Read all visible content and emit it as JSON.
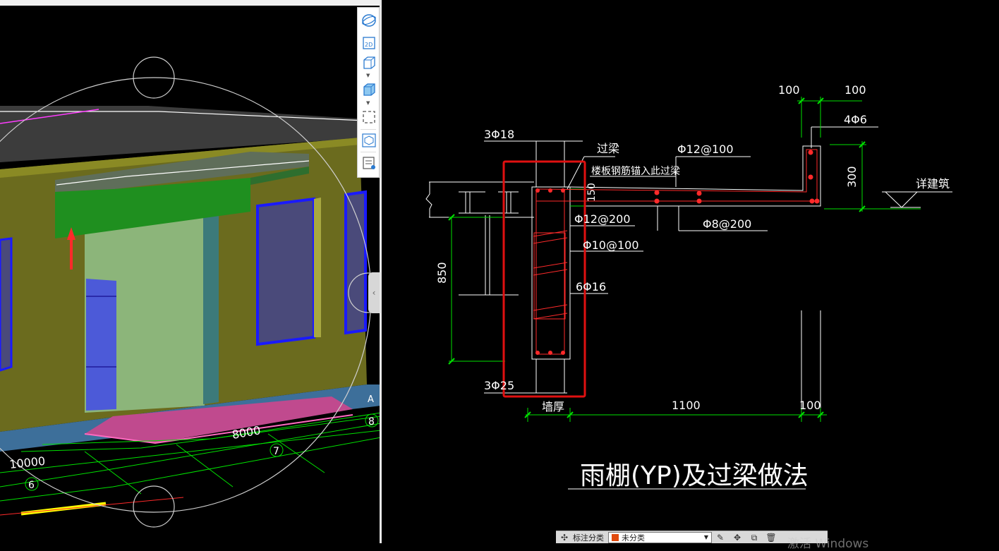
{
  "viewer3d": {
    "dim_10000": "10000",
    "dim_8000": "8000",
    "axis_6": "6",
    "axis_7": "7",
    "axis_8": "8",
    "axis_A": "A"
  },
  "toolbar": {
    "icons": [
      "orbit-icon",
      "view-2d-icon",
      "view-3d-box-icon",
      "view-solid-box-icon",
      "region-select-icon",
      "iso-view-icon",
      "properties-icon"
    ],
    "label_2d": "2D"
  },
  "drawing": {
    "title": "雨棚(YP)及过梁做法",
    "labels": {
      "top_rebar_3": "3Φ18",
      "lintel": "过梁",
      "slab_anchor_note": "楼板钢筋锚入此过梁",
      "slab_top_rebar": "Φ12@100",
      "stirrup_phi12": "Φ12@200",
      "stirrup_phi10": "Φ10@100",
      "side_rebar": "6Φ16",
      "bottom_rebar": "3Φ25",
      "dist_rebar": "Φ8@200",
      "edge_rebar": "4Φ6",
      "see_arch": "详建筑",
      "wall_thickness": "墙厚"
    },
    "dims": {
      "top_left_100": "100",
      "top_right_100": "100",
      "thickness_150": "150",
      "height_300": "300",
      "height_850": "850",
      "span_1100": "1100",
      "end_100": "100"
    },
    "colors": {
      "line_white": "#ffffff",
      "dim_green": "#00e000",
      "rebar_red": "#ff2a2a",
      "highlight_red": "#e01010"
    }
  },
  "status_bar": {
    "category_label": "标注分类",
    "category_value": "未分类",
    "category_color": "#e04b0f"
  },
  "watermark": {
    "text": "激活 Windows"
  }
}
